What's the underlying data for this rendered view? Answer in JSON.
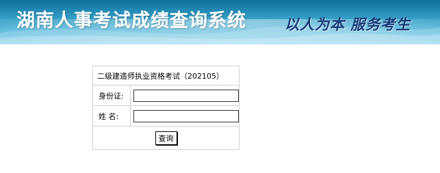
{
  "header": {
    "title": "湖南人事考试成绩查询系统",
    "slogan": "以人为本   服务考生"
  },
  "form": {
    "exam_title": "二级建造师执业资格考试（202105）",
    "id_label": "身份证:",
    "id_value": "",
    "name_label": "姓 名:",
    "name_value": "",
    "submit_label": "查询"
  },
  "colors": {
    "banner_blue": "#1f86b2",
    "slogan_navy": "#173a78"
  }
}
